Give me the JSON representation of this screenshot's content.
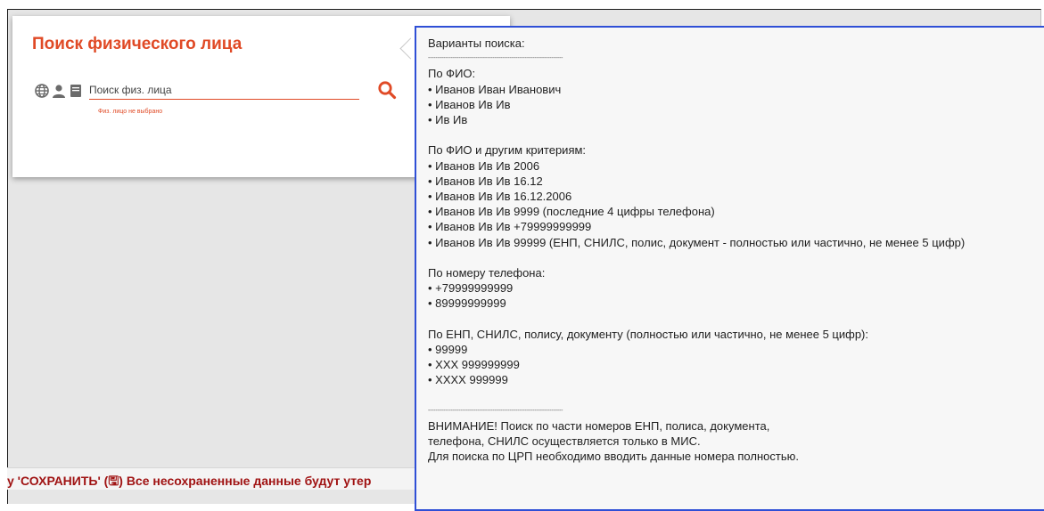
{
  "card": {
    "title": "Поиск физического лица",
    "search_placeholder": "Поиск физ. лица",
    "search_value": "",
    "hint": "Физ. лицо не выбрано",
    "icons": [
      "globe-icon",
      "person-icon",
      "card-icon",
      "search-icon"
    ]
  },
  "warning": {
    "text": "у 'СОХРАНИТЬ' (🖫) Все несохраненные данные будут утер"
  },
  "tooltip": {
    "lines": [
      "Варианты поиска:",
      "-----------------------------------------------------------------------",
      "По ФИО:",
      "• Иванов Иван Иванович",
      "• Иванов Ив Ив",
      "• Ив Ив",
      "",
      "По ФИО и другим критериям:",
      "• Иванов Ив Ив 2006",
      "• Иванов Ив Ив 16.12",
      "• Иванов Ив Ив 16.12.2006",
      "• Иванов Ив Ив 9999 (последние 4 цифры телефона)",
      "• Иванов Ив Ив +79999999999",
      "• Иванов Ив Ив 99999 (ЕНП, СНИЛС, полис, документ - полностью или частично, не менее 5 цифр)",
      "",
      "По номеру телефона:",
      "• +79999999999",
      "• 89999999999",
      "",
      "По ЕНП, СНИЛС, полису, документу (полностью или частично, не менее 5 цифр):",
      "• 99999",
      "• XXX 999999999",
      "• XXXX 999999",
      "",
      "-----------------------------------------------------------------------",
      "ВНИМАНИЕ! Поиск по части номеров ЕНП, полиса, документа,",
      " телефона, СНИЛС осуществляется только в МИС.",
      " Для поиска по ЦРП необходимо вводить данные номера полностью."
    ]
  },
  "colors": {
    "accent": "#e04a26",
    "tooltip_border": "#2f4fd6",
    "warning": "#a01313",
    "icon_gray": "#6b6b6b"
  }
}
